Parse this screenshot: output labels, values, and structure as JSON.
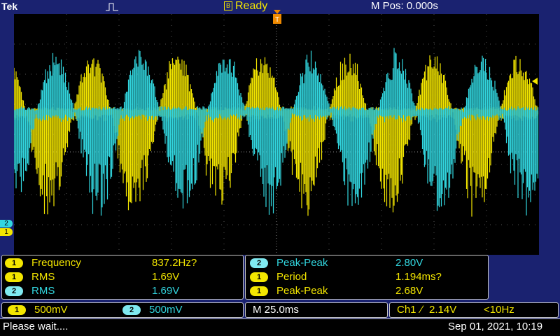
{
  "header": {
    "brand": "Tek",
    "status": "Ready",
    "status_icon": "B",
    "mpos": "M Pos: 0.000s"
  },
  "markers": {
    "ch2": "2",
    "ch1": "1",
    "trig": "T"
  },
  "measurements_left": [
    {
      "ch": "1",
      "name": "Frequency",
      "value": "837.2Hz?",
      "color": "yellow"
    },
    {
      "ch": "1",
      "name": "RMS",
      "value": "1.69V",
      "color": "yellow"
    },
    {
      "ch": "2",
      "name": "RMS",
      "value": "1.69V",
      "color": "cyan"
    }
  ],
  "measurements_right": [
    {
      "ch": "2",
      "name": "Peak-Peak",
      "value": "2.80V",
      "color": "cyan"
    },
    {
      "ch": "1",
      "name": "Period",
      "value": "1.194ms?",
      "color": "yellow"
    },
    {
      "ch": "1",
      "name": "Peak-Peak",
      "value": "2.68V",
      "color": "yellow"
    }
  ],
  "scale": {
    "ch1_chip": "1",
    "ch1": "500mV",
    "ch2_chip": "2",
    "ch2": "500mV"
  },
  "timebase": "M 25.0ms",
  "trigger": {
    "source": "Ch1",
    "slope": "∕",
    "level": "2.14V",
    "freq": "<10Hz"
  },
  "statusbar": {
    "message": "Please wait....",
    "datetime": "Sep 01, 2021, 10:19"
  },
  "colors": {
    "ch1": "#f3e600",
    "ch2": "#32d7e0",
    "background": "#1a2270"
  }
}
